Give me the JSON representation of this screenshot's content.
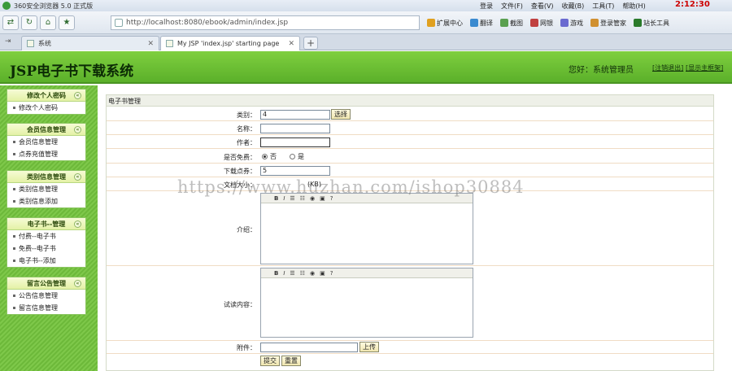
{
  "browser": {
    "title": "360安全浏览器 5.0 正式版",
    "menus": [
      "登录",
      "文件(F)",
      "查看(V)",
      "收藏(B)",
      "工具(T)",
      "帮助(H)"
    ],
    "clock": "2:12:30",
    "address": "http://localhost:8080/ebook/admin/index.jsp",
    "tools": [
      "扩展中心",
      "翻译",
      "截图",
      "网银",
      "游戏",
      "登录管家",
      "站长工具"
    ],
    "tabs": [
      {
        "label": "系统"
      },
      {
        "label": "My JSP 'index.jsp' starting page"
      }
    ]
  },
  "header": {
    "title": "JSP电子书下载系统",
    "welcome": "您好：系统管理员",
    "logout": "[注销退出]",
    "home": "[显示主框架]"
  },
  "sidebar": {
    "groups": [
      {
        "title": "修改个人密码",
        "items": [
          "修改个人密码"
        ]
      },
      {
        "title": "会员信息管理",
        "items": [
          "会员信息管理",
          "点券充值管理"
        ]
      },
      {
        "title": "类别信息管理",
        "items": [
          "类别信息管理",
          "类别信息添加"
        ]
      },
      {
        "title": "电子书--管理",
        "items": [
          "付费--电子书",
          "免费--电子书",
          "电子书--添加"
        ]
      },
      {
        "title": "留言公告管理",
        "items": [
          "公告信息管理",
          "留言信息管理"
        ]
      }
    ]
  },
  "form": {
    "caption": "电子书管理",
    "category_label": "类别：",
    "category_value": "4",
    "select_button": "选择",
    "name_label": "名称：",
    "name_value": "",
    "author_label": "作者：",
    "author_value": "",
    "free_label": "是否免费：",
    "free_no": "否",
    "free_yes": "是",
    "points_label": "下载点券：",
    "points_value": "5",
    "size_label": "文档大小：",
    "size_unit": "(KB)",
    "intro_label": "介绍：",
    "trial_label": "试读内容：",
    "attachment_label": "附件：",
    "upload_button": "上传",
    "submit_button": "提交",
    "reset_button": "重置"
  },
  "watermark": "https://www.huzhan.com/ishop30884"
}
